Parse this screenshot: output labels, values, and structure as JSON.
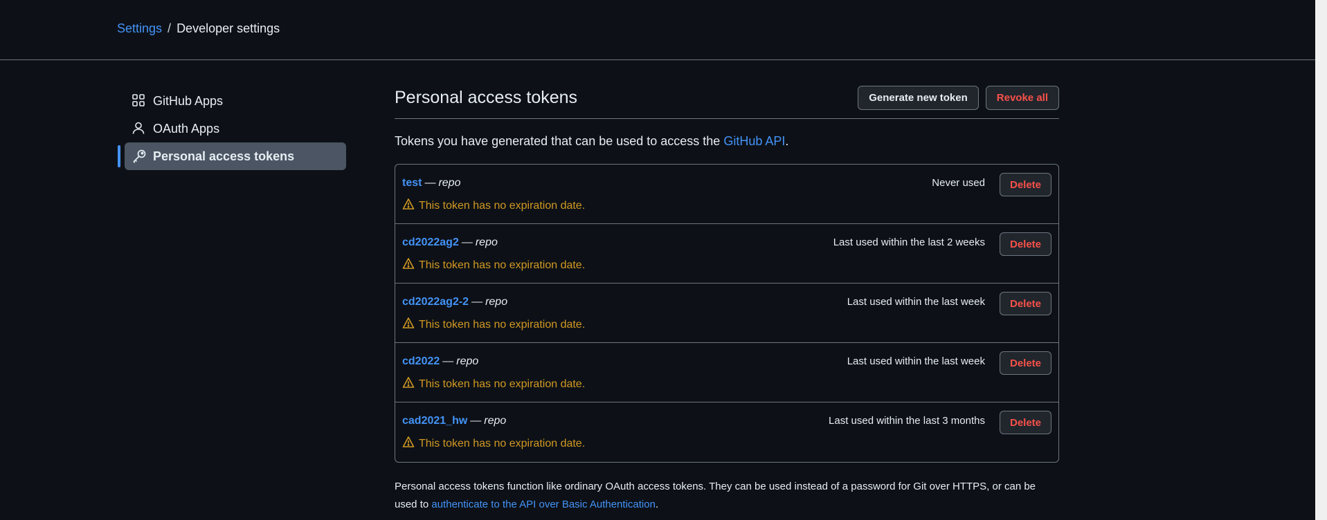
{
  "breadcrumb": {
    "settings": "Settings",
    "separator": "/",
    "current": "Developer settings"
  },
  "sidebar": {
    "items": [
      {
        "label": "GitHub Apps",
        "icon": "apps-grid-icon"
      },
      {
        "label": "OAuth Apps",
        "icon": "person-icon"
      },
      {
        "label": "Personal access tokens",
        "icon": "key-icon",
        "active": true
      }
    ]
  },
  "main": {
    "title": "Personal access tokens",
    "generate_label": "Generate new token",
    "revoke_label": "Revoke all",
    "intro_text": "Tokens you have generated that can be used to access the ",
    "intro_link": "GitHub API",
    "intro_end": "."
  },
  "tokens": [
    {
      "name": "test",
      "dash": "—",
      "scope": "repo",
      "usage": "Never used",
      "warning": "This token has no expiration date.",
      "delete_label": "Delete"
    },
    {
      "name": "cd2022ag2",
      "dash": "—",
      "scope": "repo",
      "usage": "Last used within the last 2 weeks",
      "warning": "This token has no expiration date.",
      "delete_label": "Delete"
    },
    {
      "name": "cd2022ag2-2",
      "dash": "—",
      "scope": "repo",
      "usage": "Last used within the last week",
      "warning": "This token has no expiration date.",
      "delete_label": "Delete"
    },
    {
      "name": "cd2022",
      "dash": "—",
      "scope": "repo",
      "usage": "Last used within the last week",
      "warning": "This token has no expiration date.",
      "delete_label": "Delete"
    },
    {
      "name": "cad2021_hw",
      "dash": "—",
      "scope": "repo",
      "usage": "Last used within the last 3 months",
      "warning": "This token has no expiration date.",
      "delete_label": "Delete"
    }
  ],
  "footer": {
    "text": "Personal access tokens function like ordinary OAuth access tokens. They can be used instead of a password for Git over HTTPS, or can be used to ",
    "link": "authenticate to the API over Basic Authentication",
    "end": "."
  },
  "colors": {
    "background": "#0d1117",
    "link": "#4493f8",
    "warning": "#d29922",
    "danger": "#f85149",
    "border": "#6e7681"
  }
}
